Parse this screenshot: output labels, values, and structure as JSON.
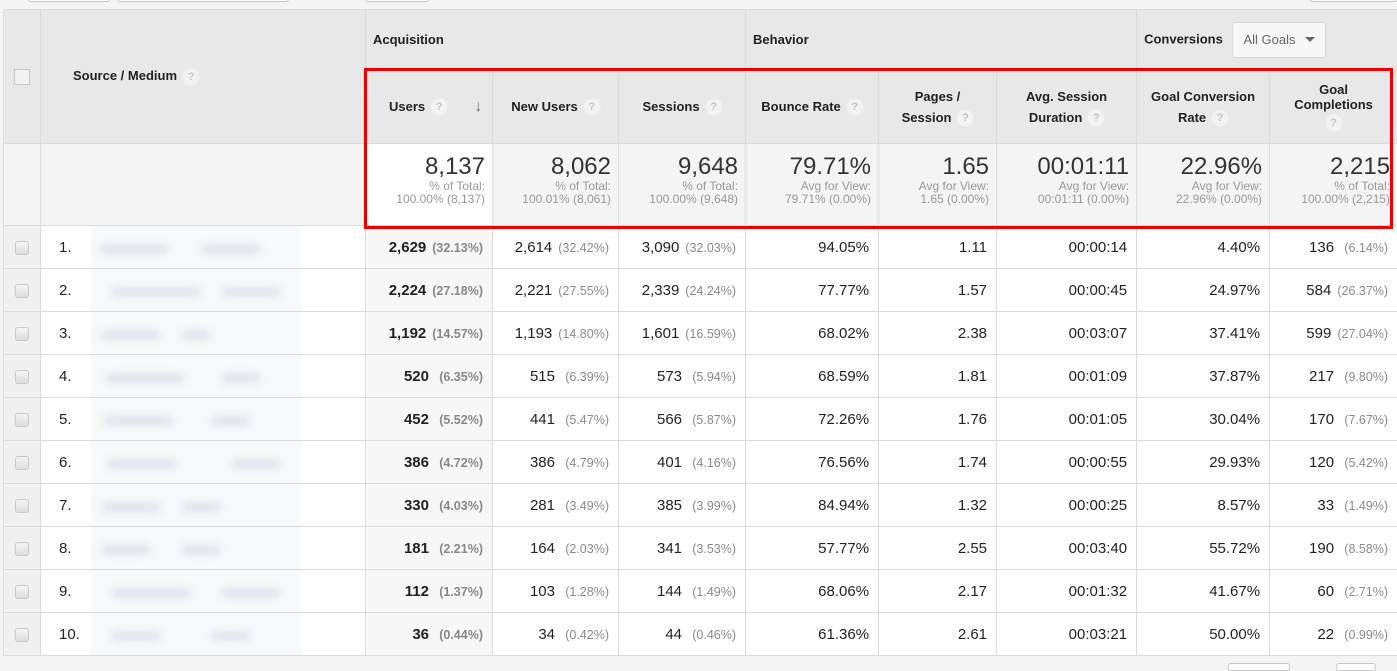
{
  "header": {
    "dimension_label": "Source / Medium",
    "groups": {
      "acquisition": "Acquisition",
      "behavior": "Behavior",
      "conversions": "Conversions"
    },
    "goal_selector": {
      "selected": "All Goals"
    },
    "columns": [
      {
        "key": "users",
        "label": "Users",
        "sorted": "descending"
      },
      {
        "key": "new_users",
        "label": "New Users"
      },
      {
        "key": "sessions",
        "label": "Sessions"
      },
      {
        "key": "bounce_rate",
        "label": "Bounce Rate"
      },
      {
        "key": "pages_session",
        "label_line1": "Pages /",
        "label_line2": "Session"
      },
      {
        "key": "avg_session_duration",
        "label_line1": "Avg. Session",
        "label_line2": "Duration"
      },
      {
        "key": "goal_conversion_rate",
        "label_line1": "Goal Conversion",
        "label_line2": "Rate"
      },
      {
        "key": "goal_completions",
        "label_line1": "Goal",
        "label_line2": "Completions"
      }
    ],
    "help_glyph": "?",
    "sort_glyph": "↓"
  },
  "totals": {
    "users": {
      "value": "8,137",
      "sub1": "% of Total:",
      "sub2": "100.00% (8,137)"
    },
    "new_users": {
      "value": "8,062",
      "sub1": "% of Total:",
      "sub2": "100.01% (8,061)"
    },
    "sessions": {
      "value": "9,648",
      "sub1": "% of Total:",
      "sub2": "100.00% (9,648)"
    },
    "bounce_rate": {
      "value": "79.71%",
      "sub1": "Avg for View:",
      "sub2": "79.71% (0.00%)"
    },
    "pages_session": {
      "value": "1.65",
      "sub1": "Avg for View:",
      "sub2": "1.65 (0.00%)"
    },
    "avg_session_duration": {
      "value": "00:01:11",
      "sub1": "Avg for View:",
      "sub2": "00:01:11 (0.00%)"
    },
    "goal_conversion_rate": {
      "value": "22.96%",
      "sub1": "Avg for View:",
      "sub2": "22.96% (0.00%)"
    },
    "goal_completions": {
      "value": "2,215",
      "sub1": "% of Total:",
      "sub2": "100.00% (2,215)"
    }
  },
  "rows": [
    {
      "index": "1.",
      "users": "2,629",
      "users_pct": "(32.13%)",
      "new_users": "2,614",
      "new_users_pct": "(32.42%)",
      "sessions": "3,090",
      "sessions_pct": "(32.03%)",
      "bounce_rate": "94.05%",
      "pages_session": "1.11",
      "avg_session_duration": "00:00:14",
      "goal_conversion_rate": "4.40%",
      "goal_completions": "136",
      "goal_completions_pct": "(6.14%)"
    },
    {
      "index": "2.",
      "users": "2,224",
      "users_pct": "(27.18%)",
      "new_users": "2,221",
      "new_users_pct": "(27.55%)",
      "sessions": "2,339",
      "sessions_pct": "(24.24%)",
      "bounce_rate": "77.77%",
      "pages_session": "1.57",
      "avg_session_duration": "00:00:45",
      "goal_conversion_rate": "24.97%",
      "goal_completions": "584",
      "goal_completions_pct": "(26.37%)"
    },
    {
      "index": "3.",
      "users": "1,192",
      "users_pct": "(14.57%)",
      "new_users": "1,193",
      "new_users_pct": "(14.80%)",
      "sessions": "1,601",
      "sessions_pct": "(16.59%)",
      "bounce_rate": "68.02%",
      "pages_session": "2.38",
      "avg_session_duration": "00:03:07",
      "goal_conversion_rate": "37.41%",
      "goal_completions": "599",
      "goal_completions_pct": "(27.04%)"
    },
    {
      "index": "4.",
      "users": "520",
      "users_pct": "(6.35%)",
      "new_users": "515",
      "new_users_pct": "(6.39%)",
      "sessions": "573",
      "sessions_pct": "(5.94%)",
      "bounce_rate": "68.59%",
      "pages_session": "1.81",
      "avg_session_duration": "00:01:09",
      "goal_conversion_rate": "37.87%",
      "goal_completions": "217",
      "goal_completions_pct": "(9.80%)"
    },
    {
      "index": "5.",
      "users": "452",
      "users_pct": "(5.52%)",
      "new_users": "441",
      "new_users_pct": "(5.47%)",
      "sessions": "566",
      "sessions_pct": "(5.87%)",
      "bounce_rate": "72.26%",
      "pages_session": "1.76",
      "avg_session_duration": "00:01:05",
      "goal_conversion_rate": "30.04%",
      "goal_completions": "170",
      "goal_completions_pct": "(7.67%)"
    },
    {
      "index": "6.",
      "users": "386",
      "users_pct": "(4.72%)",
      "new_users": "386",
      "new_users_pct": "(4.79%)",
      "sessions": "401",
      "sessions_pct": "(4.16%)",
      "bounce_rate": "76.56%",
      "pages_session": "1.74",
      "avg_session_duration": "00:00:55",
      "goal_conversion_rate": "29.93%",
      "goal_completions": "120",
      "goal_completions_pct": "(5.42%)"
    },
    {
      "index": "7.",
      "users": "330",
      "users_pct": "(4.03%)",
      "new_users": "281",
      "new_users_pct": "(3.49%)",
      "sessions": "385",
      "sessions_pct": "(3.99%)",
      "bounce_rate": "84.94%",
      "pages_session": "1.32",
      "avg_session_duration": "00:00:25",
      "goal_conversion_rate": "8.57%",
      "goal_completions": "33",
      "goal_completions_pct": "(1.49%)"
    },
    {
      "index": "8.",
      "users": "181",
      "users_pct": "(2.21%)",
      "new_users": "164",
      "new_users_pct": "(2.03%)",
      "sessions": "341",
      "sessions_pct": "(3.53%)",
      "bounce_rate": "57.77%",
      "pages_session": "2.55",
      "avg_session_duration": "00:03:40",
      "goal_conversion_rate": "55.72%",
      "goal_completions": "190",
      "goal_completions_pct": "(8.58%)"
    },
    {
      "index": "9.",
      "users": "112",
      "users_pct": "(1.37%)",
      "new_users": "103",
      "new_users_pct": "(1.28%)",
      "sessions": "144",
      "sessions_pct": "(1.49%)",
      "bounce_rate": "68.06%",
      "pages_session": "2.17",
      "avg_session_duration": "00:01:32",
      "goal_conversion_rate": "41.67%",
      "goal_completions": "60",
      "goal_completions_pct": "(2.71%)"
    },
    {
      "index": "10.",
      "users": "36",
      "users_pct": "(0.44%)",
      "new_users": "34",
      "new_users_pct": "(0.42%)",
      "sessions": "44",
      "sessions_pct": "(0.46%)",
      "bounce_rate": "61.36%",
      "pages_session": "2.61",
      "avg_session_duration": "00:03:21",
      "goal_conversion_rate": "50.00%",
      "goal_completions": "22",
      "goal_completions_pct": "(0.99%)"
    }
  ],
  "colors": {
    "highlight_box": "#ee0000",
    "header_bg": "#e8e8e8",
    "border": "#dcdcdc"
  }
}
